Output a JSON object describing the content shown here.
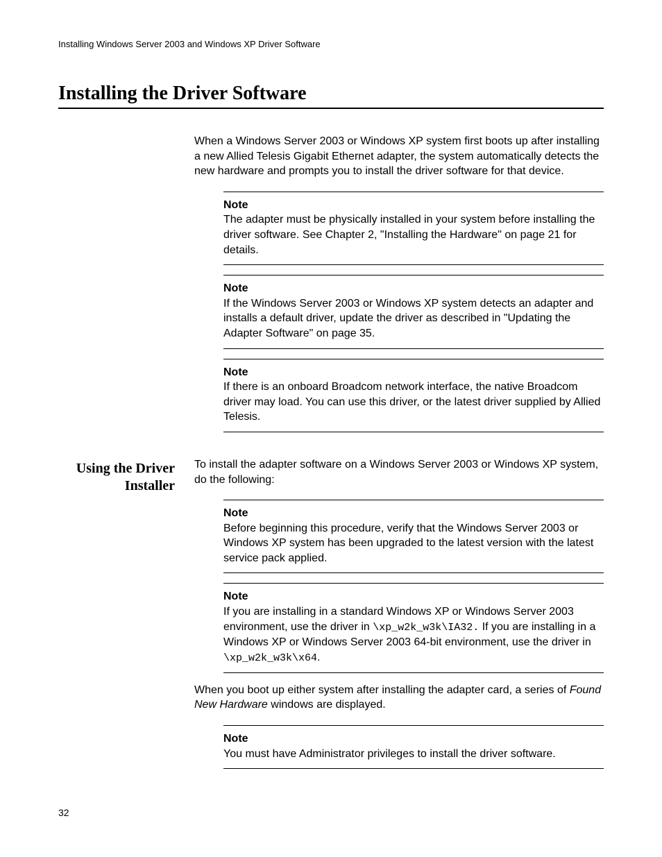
{
  "runningHeader": "Installing Windows Server 2003 and Windows XP Driver Software",
  "sectionTitle": "Installing the Driver Software",
  "introPara": "When a Windows Server 2003 or Windows XP system first boots up after installing a new Allied Telesis Gigabit Ethernet adapter, the system automatically detects the new hardware and prompts you to install the driver software for that device.",
  "note1": {
    "label": "Note",
    "text": "The adapter must be physically installed in your system before installing the driver software. See Chapter 2, \"Installing the Hardware\" on page 21 for details."
  },
  "note2": {
    "label": "Note",
    "text": "If the Windows Server 2003 or Windows XP system detects an adapter and installs a default driver, update the driver as described in \"Updating the Adapter Software\" on page 35."
  },
  "note3": {
    "label": "Note",
    "text": "If there is an onboard Broadcom network interface, the native Broadcom driver may load. You can use this driver, or the latest driver supplied by Allied Telesis."
  },
  "subheading": "Using the Driver Installer",
  "installPara": "To install the adapter software on a Windows Server 2003 or Windows XP system, do the following:",
  "note4": {
    "label": "Note",
    "text": "Before beginning this procedure, verify that the Windows Server 2003 or Windows XP system has been upgraded to the latest version with the latest service pack applied."
  },
  "note5": {
    "label": "Note",
    "pre": "If you are installing in a standard Windows XP or Windows Server 2003 environment, use the driver in ",
    "path1": "\\xp_w2k_w3k\\IA32.",
    "mid": " If you are installing in a Windows XP or Windows Server 2003 64-bit environment, use the driver in ",
    "path2": "\\xp_w2k_w3k\\x64",
    "post": "."
  },
  "bootPara": {
    "pre": "When you boot up either system after installing the adapter card, a series of ",
    "ital": "Found New Hardware",
    "post": " windows are displayed."
  },
  "note6": {
    "label": "Note",
    "text": "You must have Administrator privileges to install the driver software."
  },
  "pageNumber": "32"
}
